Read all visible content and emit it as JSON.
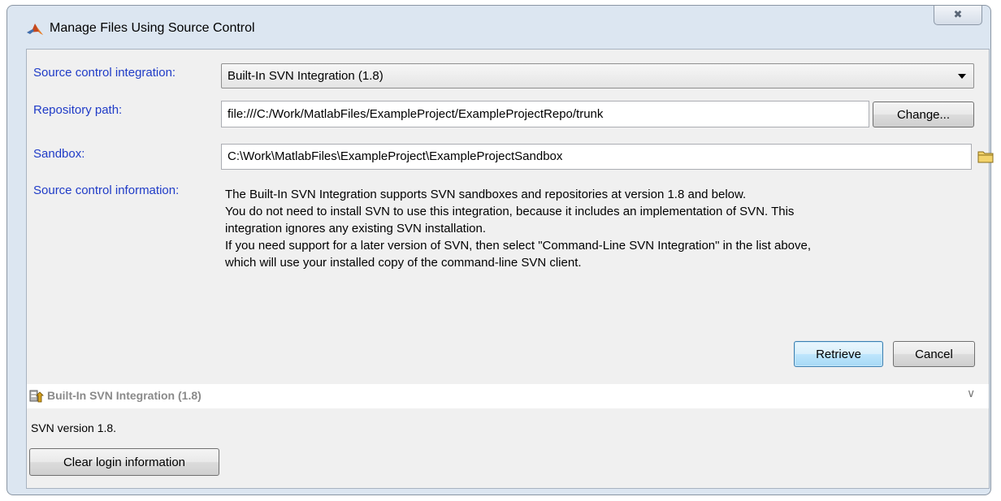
{
  "window": {
    "title": "Manage Files Using Source Control",
    "close_glyph": "✖"
  },
  "form": {
    "integration_label": "Source control integration:",
    "integration_value": "Built-In SVN Integration (1.8)",
    "repository_label": "Repository path:",
    "repository_value": "file:///C:/Work/MatlabFiles/ExampleProject/ExampleProjectRepo/trunk",
    "change_button": "Change...",
    "sandbox_label": "Sandbox:",
    "sandbox_value": "C:\\Work\\MatlabFiles\\ExampleProject\\ExampleProjectSandbox",
    "info_label": "Source control information:",
    "info_lines": [
      "The Built-In SVN Integration supports SVN sandboxes and repositories at version 1.8 and below.",
      "You do not need to install SVN to use this integration, because it includes an implementation of SVN. This",
      "integration ignores any existing SVN installation.",
      "If you need support for a later version of SVN, then select \"Command-Line SVN Integration\" in the list above,",
      "which will use your installed copy of the command-line SVN client."
    ],
    "retrieve_button": "Retrieve",
    "cancel_button": "Cancel"
  },
  "panel": {
    "title": "Built-In SVN Integration (1.8)",
    "chevron_glyph": "∨",
    "version_text": "SVN version 1.8.",
    "clear_button": "Clear login information"
  },
  "icons": {
    "app": "matlab-logo-icon",
    "folder": "folder-icon",
    "panel": "svn-integration-icon",
    "chevron": "chevron-down-icon"
  }
}
